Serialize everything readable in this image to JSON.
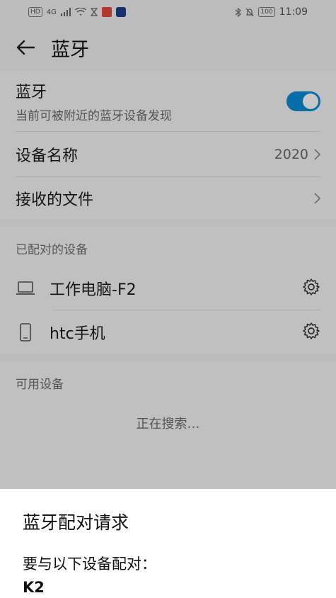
{
  "status_bar": {
    "left_badge_hd": "HD",
    "left_signal": "4G",
    "battery": "100",
    "time": "11:09"
  },
  "header": {
    "title": "蓝牙"
  },
  "bluetooth_toggle": {
    "title": "蓝牙",
    "subtitle": "当前可被附近的蓝牙设备发现",
    "enabled": true,
    "accent_color": "#0a8dd8"
  },
  "device_name_row": {
    "label": "设备名称",
    "value": "2020"
  },
  "received_files_row": {
    "label": "接收的文件"
  },
  "paired_devices": {
    "header": "已配对的设备",
    "items": [
      {
        "name": "工作电脑-F2",
        "icon": "laptop-icon"
      },
      {
        "name": "htc手机",
        "icon": "phone-icon"
      }
    ]
  },
  "available_devices": {
    "header": "可用设备",
    "status": "正在搜索…"
  },
  "dialog": {
    "title": "蓝牙配对请求",
    "message": "要与以下设备配对：",
    "device": "K2"
  }
}
